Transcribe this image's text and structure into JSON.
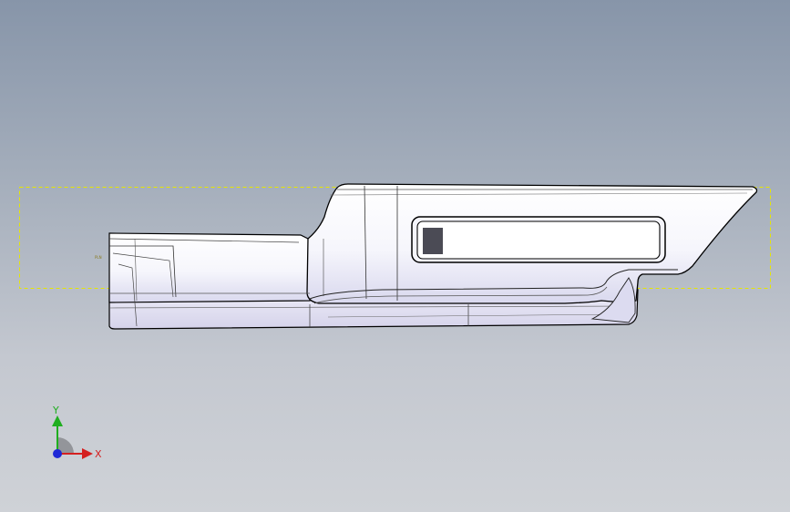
{
  "viewport": {
    "background_top": "#8795a9",
    "background_bottom": "#cfd2d7"
  },
  "model": {
    "name": "door-panel-trim",
    "edge_color": "#000000",
    "face_color": "#ffffff",
    "shade_color": "#e3e2f2",
    "bounding_box_color": "#e6e600",
    "sketch_origin_label": "PLN"
  },
  "triad": {
    "x_label": "X",
    "y_label": "Y",
    "x_color": "#d42020",
    "y_color": "#1fae1f",
    "z_color": "#1f28d6"
  }
}
